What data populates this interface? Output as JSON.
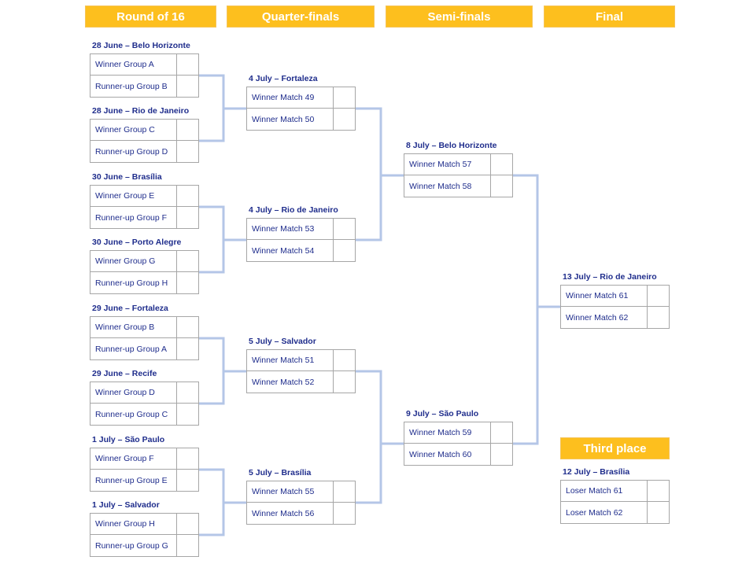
{
  "headers": {
    "round_of_16": "Round of 16",
    "quarter_finals": "Quarter-finals",
    "semi_finals": "Semi-finals",
    "final": "Final",
    "third_place": "Third place"
  },
  "colors": {
    "header_bg": "#FDBF1E",
    "header_text": "#FFFFFF",
    "label_text": "#1F2D8C",
    "connector": "#B4C6E7",
    "box_border": "#A6A6A6"
  },
  "round_of_16": [
    {
      "label": "28 June – Belo Horizonte",
      "teams": [
        "Winner Group A",
        "Runner-up Group B"
      ],
      "scores": [
        "",
        ""
      ]
    },
    {
      "label": "28 June – Rio de Janeiro",
      "teams": [
        "Winner Group C",
        "Runner-up Group D"
      ],
      "scores": [
        "",
        ""
      ]
    },
    {
      "label": "30 June – Brasília",
      "teams": [
        "Winner Group E",
        "Runner-up Group F"
      ],
      "scores": [
        "",
        ""
      ]
    },
    {
      "label": "30 June – Porto Alegre",
      "teams": [
        "Winner Group G",
        "Runner-up Group H"
      ],
      "scores": [
        "",
        ""
      ]
    },
    {
      "label": "29 June – Fortaleza",
      "teams": [
        "Winner Group B",
        "Runner-up Group A"
      ],
      "scores": [
        "",
        ""
      ]
    },
    {
      "label": "29 June – Recife",
      "teams": [
        "Winner Group D",
        "Runner-up Group C"
      ],
      "scores": [
        "",
        ""
      ]
    },
    {
      "label": "1 July – São Paulo",
      "teams": [
        "Winner Group F",
        "Runner-up Group E"
      ],
      "scores": [
        "",
        ""
      ]
    },
    {
      "label": "1 July – Salvador",
      "teams": [
        "Winner Group H",
        "Runner-up Group G"
      ],
      "scores": [
        "",
        ""
      ]
    }
  ],
  "quarter_finals": [
    {
      "label": "4 July – Fortaleza",
      "teams": [
        "Winner Match 49",
        "Winner Match 50"
      ],
      "scores": [
        "",
        ""
      ]
    },
    {
      "label": "4 July – Rio de Janeiro",
      "teams": [
        "Winner Match 53",
        "Winner Match 54"
      ],
      "scores": [
        "",
        ""
      ]
    },
    {
      "label": "5 July – Salvador",
      "teams": [
        "Winner Match 51",
        "Winner Match 52"
      ],
      "scores": [
        "",
        ""
      ]
    },
    {
      "label": "5 July – Brasília",
      "teams": [
        "Winner Match 55",
        "Winner Match 56"
      ],
      "scores": [
        "",
        ""
      ]
    }
  ],
  "semi_finals": [
    {
      "label": "8 July – Belo Horizonte",
      "teams": [
        "Winner Match 57",
        "Winner Match 58"
      ],
      "scores": [
        "",
        ""
      ]
    },
    {
      "label": "9 July – São Paulo",
      "teams": [
        "Winner Match 59",
        "Winner Match 60"
      ],
      "scores": [
        "",
        ""
      ]
    }
  ],
  "final": {
    "label": "13 July – Rio de Janeiro",
    "teams": [
      "Winner Match 61",
      "Winner Match 62"
    ],
    "scores": [
      "",
      ""
    ]
  },
  "third_place": {
    "label": "12 July – Brasília",
    "teams": [
      "Loser Match 61",
      "Loser Match 62"
    ],
    "scores": [
      "",
      ""
    ]
  }
}
